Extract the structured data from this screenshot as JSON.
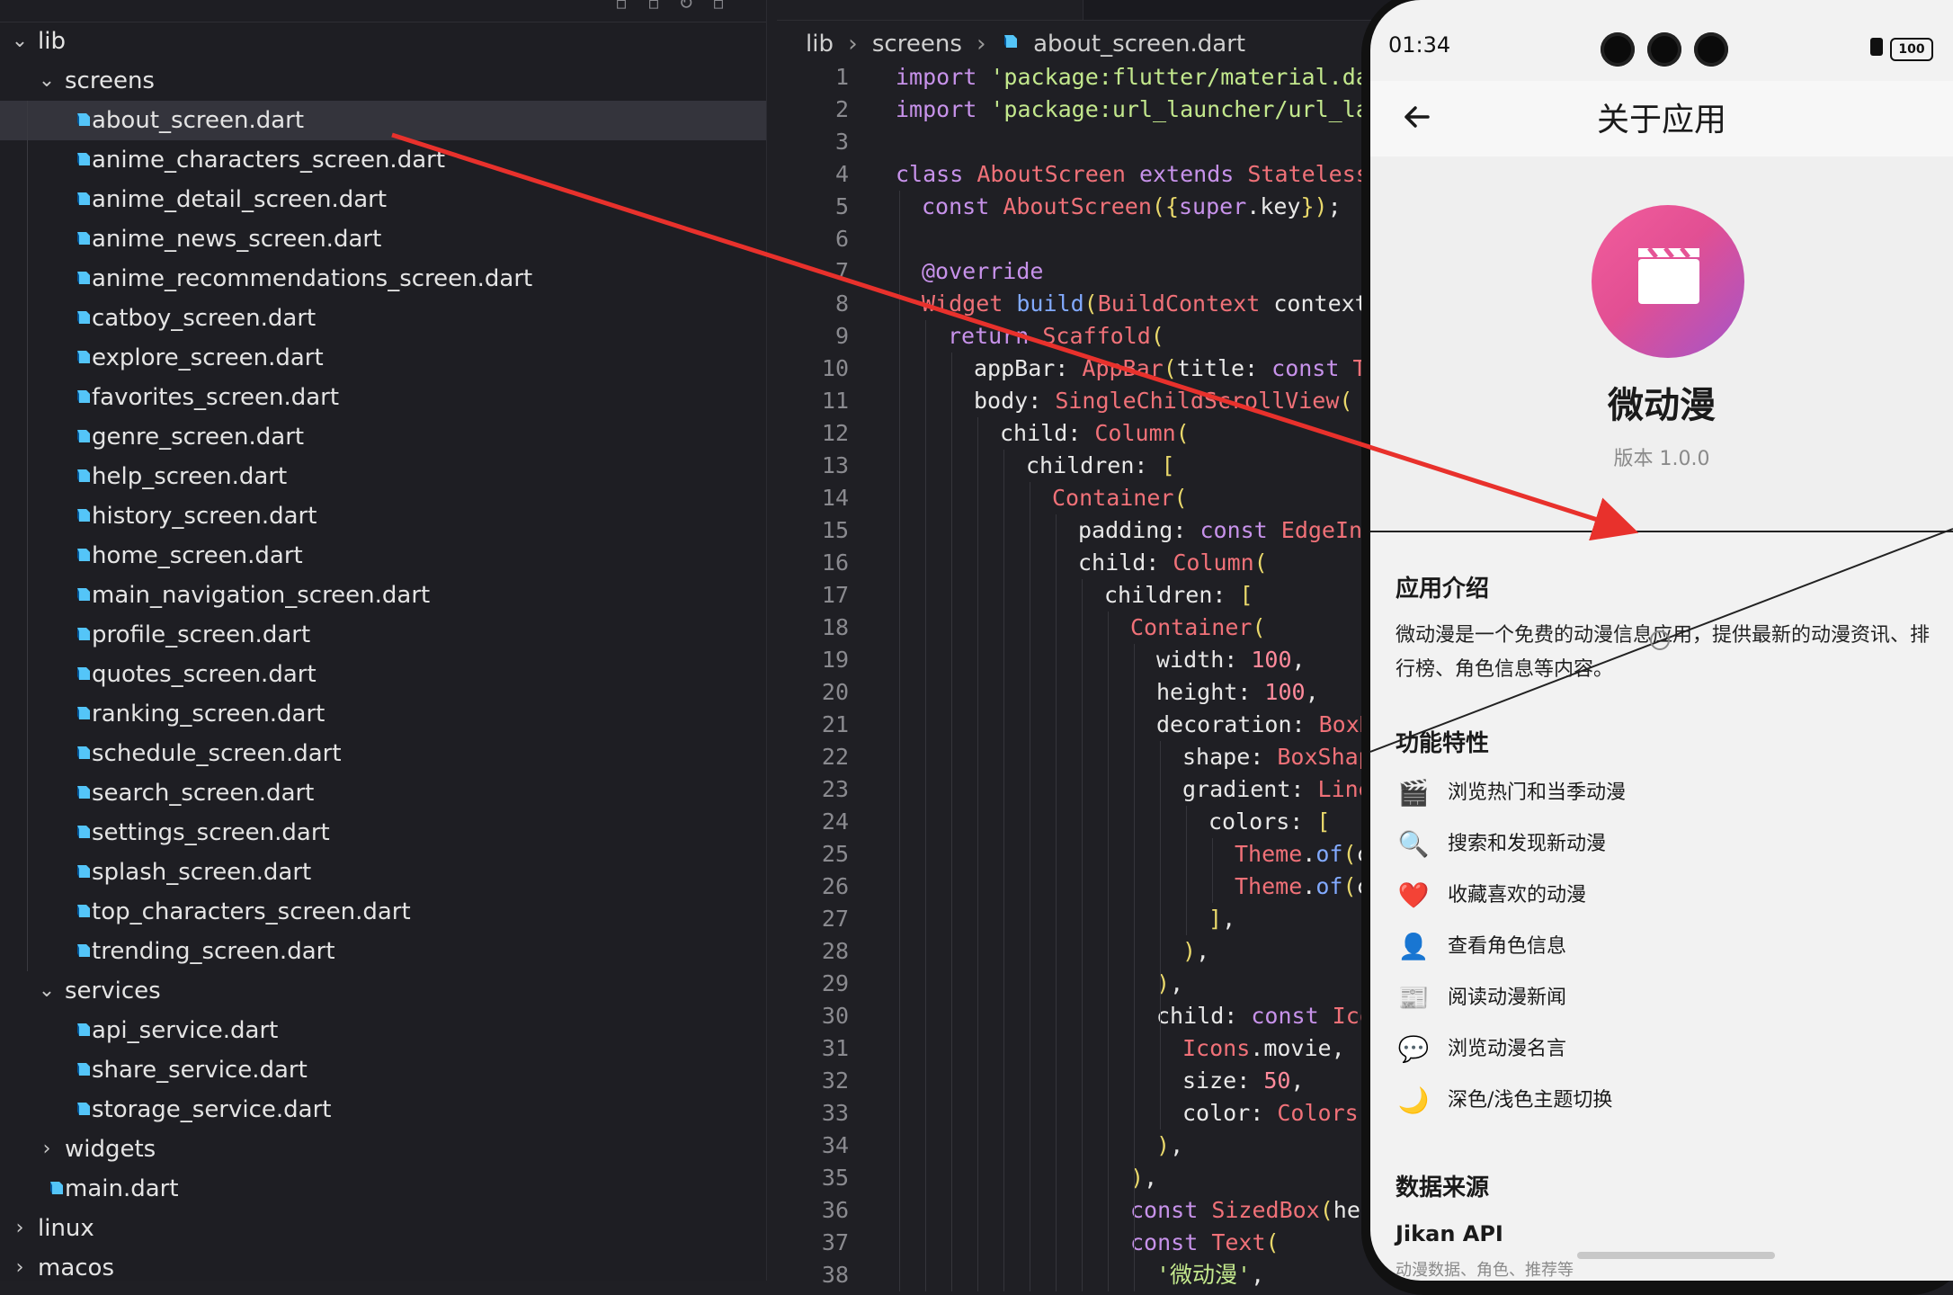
{
  "explorer": {
    "rows": [
      {
        "label": "lib",
        "type": "folder-open",
        "depth": 0
      },
      {
        "label": "screens",
        "type": "folder-open",
        "depth": 1
      },
      {
        "label": "about_screen.dart",
        "type": "dart",
        "depth": 2,
        "selected": true
      },
      {
        "label": "anime_characters_screen.dart",
        "type": "dart",
        "depth": 2
      },
      {
        "label": "anime_detail_screen.dart",
        "type": "dart",
        "depth": 2
      },
      {
        "label": "anime_news_screen.dart",
        "type": "dart",
        "depth": 2
      },
      {
        "label": "anime_recommendations_screen.dart",
        "type": "dart",
        "depth": 2
      },
      {
        "label": "catboy_screen.dart",
        "type": "dart",
        "depth": 2
      },
      {
        "label": "explore_screen.dart",
        "type": "dart",
        "depth": 2
      },
      {
        "label": "favorites_screen.dart",
        "type": "dart",
        "depth": 2
      },
      {
        "label": "genre_screen.dart",
        "type": "dart",
        "depth": 2
      },
      {
        "label": "help_screen.dart",
        "type": "dart",
        "depth": 2
      },
      {
        "label": "history_screen.dart",
        "type": "dart",
        "depth": 2
      },
      {
        "label": "home_screen.dart",
        "type": "dart",
        "depth": 2
      },
      {
        "label": "main_navigation_screen.dart",
        "type": "dart",
        "depth": 2
      },
      {
        "label": "profile_screen.dart",
        "type": "dart",
        "depth": 2
      },
      {
        "label": "quotes_screen.dart",
        "type": "dart",
        "depth": 2
      },
      {
        "label": "ranking_screen.dart",
        "type": "dart",
        "depth": 2
      },
      {
        "label": "schedule_screen.dart",
        "type": "dart",
        "depth": 2
      },
      {
        "label": "search_screen.dart",
        "type": "dart",
        "depth": 2
      },
      {
        "label": "settings_screen.dart",
        "type": "dart",
        "depth": 2
      },
      {
        "label": "splash_screen.dart",
        "type": "dart",
        "depth": 2
      },
      {
        "label": "top_characters_screen.dart",
        "type": "dart",
        "depth": 2
      },
      {
        "label": "trending_screen.dart",
        "type": "dart",
        "depth": 2
      },
      {
        "label": "services",
        "type": "folder-open",
        "depth": 1
      },
      {
        "label": "api_service.dart",
        "type": "dart",
        "depth": 2
      },
      {
        "label": "share_service.dart",
        "type": "dart",
        "depth": 2
      },
      {
        "label": "storage_service.dart",
        "type": "dart",
        "depth": 2
      },
      {
        "label": "widgets",
        "type": "folder-closed",
        "depth": 1
      },
      {
        "label": "main.dart",
        "type": "dart",
        "depth": 1
      },
      {
        "label": "linux",
        "type": "folder-closed",
        "depth": 0
      },
      {
        "label": "macos",
        "type": "folder-closed",
        "depth": 0
      }
    ]
  },
  "editor": {
    "breadcrumb": [
      "lib",
      "screens",
      "about_screen.dart"
    ],
    "lines": [
      {
        "n": "1",
        "i": 0,
        "t": [
          [
            "kw",
            "import "
          ],
          [
            "st",
            "'package:flutter/material.dar"
          ]
        ]
      },
      {
        "n": "2",
        "i": 0,
        "t": [
          [
            "kw",
            "import "
          ],
          [
            "st",
            "'package:url_launcher/url_lau"
          ]
        ]
      },
      {
        "n": "3",
        "i": 0,
        "t": []
      },
      {
        "n": "4",
        "i": 0,
        "t": [
          [
            "kw",
            "class "
          ],
          [
            "tp",
            "AboutScreen "
          ],
          [
            "kw",
            "extends "
          ],
          [
            "tp",
            "StatelessW"
          ]
        ]
      },
      {
        "n": "5",
        "i": 1,
        "t": [
          [
            "kw",
            "const "
          ],
          [
            "tp",
            "AboutScreen"
          ],
          [
            "br",
            "({"
          ],
          [
            "kw",
            "super"
          ],
          [
            "pn",
            ".key"
          ],
          [
            "br",
            "})"
          ],
          [
            "pn",
            ";"
          ]
        ]
      },
      {
        "n": "6",
        "i": 0,
        "t": []
      },
      {
        "n": "7",
        "i": 1,
        "t": [
          [
            "ann",
            "@override"
          ]
        ]
      },
      {
        "n": "8",
        "i": 1,
        "t": [
          [
            "tp",
            "Widget "
          ],
          [
            "fn",
            "build"
          ],
          [
            "br",
            "("
          ],
          [
            "tp",
            "BuildContext "
          ],
          [
            "pn",
            "context"
          ],
          [
            "br",
            ")"
          ]
        ]
      },
      {
        "n": "9",
        "i": 2,
        "t": [
          [
            "kw",
            "return "
          ],
          [
            "tp",
            "Scaffold"
          ],
          [
            "br",
            "("
          ]
        ]
      },
      {
        "n": "10",
        "i": 3,
        "t": [
          [
            "pn",
            "appBar: "
          ],
          [
            "tp",
            "AppBar"
          ],
          [
            "br",
            "("
          ],
          [
            "pn",
            "title: "
          ],
          [
            "kw",
            "const "
          ],
          [
            "tp",
            "Te"
          ]
        ]
      },
      {
        "n": "11",
        "i": 3,
        "t": [
          [
            "pn",
            "body: "
          ],
          [
            "tp",
            "SingleChildScrollView"
          ],
          [
            "br",
            "("
          ]
        ]
      },
      {
        "n": "12",
        "i": 4,
        "t": [
          [
            "pn",
            "child: "
          ],
          [
            "tp",
            "Column"
          ],
          [
            "br",
            "("
          ]
        ]
      },
      {
        "n": "13",
        "i": 5,
        "t": [
          [
            "pn",
            "children: "
          ],
          [
            "br",
            "["
          ]
        ]
      },
      {
        "n": "14",
        "i": 6,
        "t": [
          [
            "tp",
            "Container"
          ],
          [
            "br",
            "("
          ]
        ]
      },
      {
        "n": "15",
        "i": 7,
        "t": [
          [
            "pn",
            "padding: "
          ],
          [
            "kw",
            "const "
          ],
          [
            "tp",
            "EdgeIns"
          ]
        ]
      },
      {
        "n": "16",
        "i": 7,
        "t": [
          [
            "pn",
            "child: "
          ],
          [
            "tp",
            "Column"
          ],
          [
            "br",
            "("
          ]
        ]
      },
      {
        "n": "17",
        "i": 8,
        "t": [
          [
            "pn",
            "children: "
          ],
          [
            "br",
            "["
          ]
        ]
      },
      {
        "n": "18",
        "i": 9,
        "t": [
          [
            "tp",
            "Container"
          ],
          [
            "br",
            "("
          ]
        ]
      },
      {
        "n": "19",
        "i": 10,
        "t": [
          [
            "pn",
            "width: "
          ],
          [
            "nm",
            "100"
          ],
          [
            "pn",
            ","
          ]
        ]
      },
      {
        "n": "20",
        "i": 10,
        "t": [
          [
            "pn",
            "height: "
          ],
          [
            "nm",
            "100"
          ],
          [
            "pn",
            ","
          ]
        ]
      },
      {
        "n": "21",
        "i": 10,
        "t": [
          [
            "pn",
            "decoration: "
          ],
          [
            "tp",
            "BoxD"
          ]
        ]
      },
      {
        "n": "22",
        "i": 11,
        "t": [
          [
            "pn",
            "shape: "
          ],
          [
            "tp",
            "BoxShap"
          ]
        ]
      },
      {
        "n": "23",
        "i": 11,
        "t": [
          [
            "pn",
            "gradient: "
          ],
          [
            "tp",
            "Line"
          ]
        ]
      },
      {
        "n": "24",
        "i": 12,
        "t": [
          [
            "pn",
            "colors: "
          ],
          [
            "br",
            "["
          ]
        ]
      },
      {
        "n": "25",
        "i": 13,
        "t": [
          [
            "tp",
            "Theme"
          ],
          [
            "pn",
            "."
          ],
          [
            "fn",
            "of"
          ],
          [
            "br",
            "("
          ],
          [
            "pn",
            "c"
          ]
        ]
      },
      {
        "n": "26",
        "i": 13,
        "t": [
          [
            "tp",
            "Theme"
          ],
          [
            "pn",
            "."
          ],
          [
            "fn",
            "of"
          ],
          [
            "br",
            "("
          ],
          [
            "pn",
            "c"
          ]
        ]
      },
      {
        "n": "27",
        "i": 12,
        "t": [
          [
            "br",
            "]"
          ],
          [
            "pn",
            ","
          ]
        ]
      },
      {
        "n": "28",
        "i": 11,
        "t": [
          [
            "br",
            ")"
          ],
          [
            "pn",
            ","
          ]
        ]
      },
      {
        "n": "29",
        "i": 10,
        "t": [
          [
            "br",
            ")"
          ],
          [
            "pn",
            ","
          ]
        ]
      },
      {
        "n": "30",
        "i": 10,
        "t": [
          [
            "pn",
            "child: "
          ],
          [
            "kw",
            "const "
          ],
          [
            "tp",
            "Ico"
          ]
        ]
      },
      {
        "n": "31",
        "i": 11,
        "t": [
          [
            "tp",
            "Icons"
          ],
          [
            "pn",
            ".movie,"
          ]
        ]
      },
      {
        "n": "32",
        "i": 11,
        "t": [
          [
            "pn",
            "size: "
          ],
          [
            "nm",
            "50"
          ],
          [
            "pn",
            ","
          ]
        ]
      },
      {
        "n": "33",
        "i": 11,
        "t": [
          [
            "pn",
            "color: "
          ],
          [
            "tp",
            "Colors"
          ],
          [
            "pn",
            "."
          ]
        ]
      },
      {
        "n": "34",
        "i": 10,
        "t": [
          [
            "br",
            ")"
          ],
          [
            "pn",
            ","
          ]
        ]
      },
      {
        "n": "35",
        "i": 9,
        "t": [
          [
            "br",
            ")"
          ],
          [
            "pn",
            ","
          ]
        ]
      },
      {
        "n": "36",
        "i": 9,
        "t": [
          [
            "kw",
            "const "
          ],
          [
            "tp",
            "SizedBox"
          ],
          [
            "br",
            "("
          ],
          [
            "pn",
            "hei"
          ]
        ]
      },
      {
        "n": "37",
        "i": 9,
        "t": [
          [
            "kw",
            "const "
          ],
          [
            "tp",
            "Text"
          ],
          [
            "br",
            "("
          ]
        ]
      },
      {
        "n": "38",
        "i": 10,
        "t": [
          [
            "st",
            "'微动漫'"
          ],
          [
            "pn",
            ","
          ]
        ]
      }
    ]
  },
  "phone": {
    "clock": "01:34",
    "battery": "100",
    "app_bar_title": "关于应用",
    "app_name": "微动漫",
    "version": "版本 1.0.0",
    "intro_title": "应用介绍",
    "intro_text": "微动漫是一个免费的动漫信息应用，提供最新的动漫资讯、排行榜、角色信息等内容。",
    "features_title": "功能特性",
    "features": [
      {
        "icon": "🎬",
        "icon_name": "clapperboard-icon",
        "text": "浏览热门和当季动漫"
      },
      {
        "icon": "🔍",
        "icon_name": "magnifier-icon",
        "text": "搜索和发现新动漫"
      },
      {
        "icon": "❤️",
        "icon_name": "heart-icon",
        "text": "收藏喜欢的动漫"
      },
      {
        "icon": "👤",
        "icon_name": "person-icon",
        "text": "查看角色信息"
      },
      {
        "icon": "📰",
        "icon_name": "newspaper-icon",
        "text": "阅读动漫新闻"
      },
      {
        "icon": "💬",
        "icon_name": "speech-bubble-icon",
        "text": "浏览动漫名言"
      },
      {
        "icon": "🌙",
        "icon_name": "moon-icon",
        "text": "深色/浅色主题切换"
      }
    ],
    "data_source_title": "数据来源",
    "api_name": "Jikan API",
    "api_desc": "动漫数据、角色、推荐等"
  },
  "colors": {
    "arrow": "#e8312c",
    "dart_icon": "#54c5f8",
    "logo_gradient_start": "#f25d9c",
    "logo_gradient_end": "#a455c9"
  }
}
